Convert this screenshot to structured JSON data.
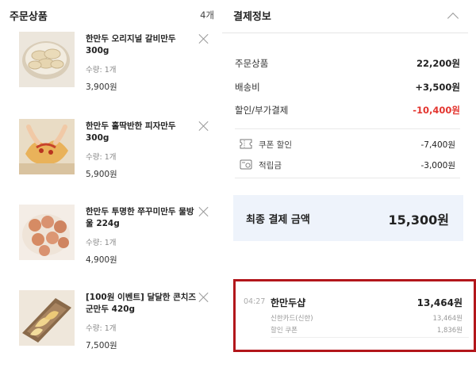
{
  "order": {
    "title": "주문상품",
    "count": "4개",
    "items": [
      {
        "name": "한만두 오리지널 갈비만두 300g",
        "qty": "수량: 1개",
        "price": "3,900원",
        "thumb_icon": "dumpling-plate-image"
      },
      {
        "name": "한만두 홀딱반한 피자만두 300g",
        "qty": "수량: 1개",
        "price": "5,900원",
        "thumb_icon": "pizza-dumpling-image"
      },
      {
        "name": "한만두 투명한 쭈꾸미만두 물방울 224g",
        "qty": "수량: 1개",
        "price": "4,900원",
        "thumb_icon": "octopus-dumpling-image"
      },
      {
        "name": "[100원 이벤트] 달달한 콘치즈 군만두 420g",
        "qty": "수량: 1개",
        "price": "7,500원",
        "thumb_icon": "corn-cheese-dumpling-image"
      }
    ]
  },
  "payment": {
    "title": "결제정보",
    "rows": [
      {
        "label": "주문상품",
        "value": "22,200원"
      },
      {
        "label": "배송비",
        "value": "+3,500원"
      },
      {
        "label": "할인/부가결제",
        "value": "-10,400원"
      }
    ],
    "discounts": [
      {
        "label": "쿠폰 할인",
        "value": "-7,400원",
        "icon": "coupon-icon"
      },
      {
        "label": "적립금",
        "value": "-3,000원",
        "icon": "points-icon"
      }
    ],
    "total_label": "최종 결제 금액",
    "total_value": "15,300원",
    "history": {
      "time": "04:27",
      "store": "한만두샵",
      "amount": "13,464원",
      "lines": [
        {
          "label": "신한카드(신한)",
          "value": "13,464원"
        },
        {
          "label": "할인 쿠폰",
          "value": "1,836원"
        }
      ]
    }
  },
  "colors": {
    "accent_red": "#e3352f",
    "highlight_border": "#b2161b",
    "total_bg": "#eef3fb"
  }
}
